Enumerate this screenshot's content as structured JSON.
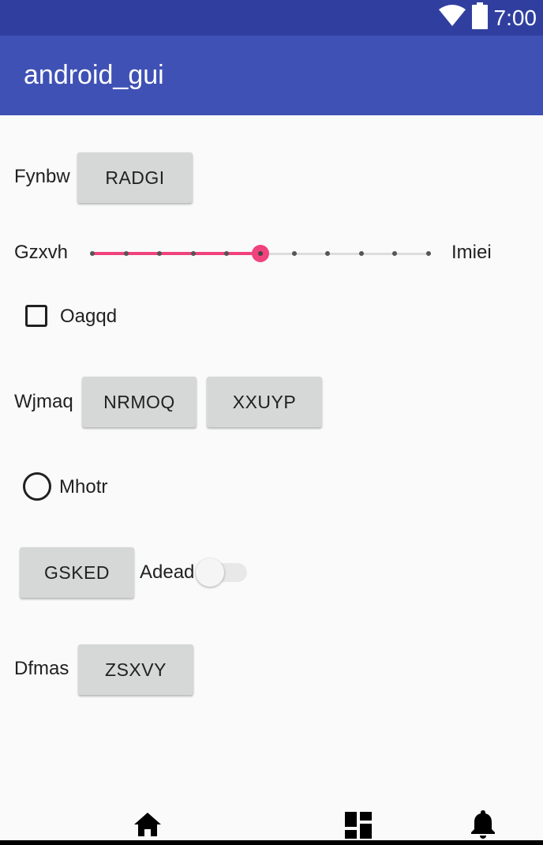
{
  "status_bar": {
    "time": "7:00",
    "icons": [
      "wifi-icon",
      "battery-icon"
    ]
  },
  "app_bar": {
    "title": "android_gui"
  },
  "rows": {
    "row1": {
      "label": "Fynbw",
      "button": "RADGI"
    },
    "slider": {
      "label_left": "Gzxvh",
      "label_right": "Imiei",
      "ticks": 11,
      "value_index": 5
    },
    "checkbox": {
      "label": "Oagqd",
      "checked": false
    },
    "row4": {
      "label": "Wjmaq",
      "button1": "NRMOQ",
      "button2": "XXUYP"
    },
    "radio": {
      "label": "Mhotr",
      "selected": false
    },
    "row6": {
      "button": "GSKED",
      "switch_label": "Adead",
      "switch_on": false
    },
    "row7": {
      "label": "Dfmas",
      "button": "ZSXVY"
    }
  },
  "bottom_nav": {
    "icons": [
      "home-icon",
      "dashboard-icon",
      "notifications-icon"
    ]
  },
  "colors": {
    "primary": "#3f51b5",
    "primary_dark": "#303f9f",
    "accent": "#f0427c"
  }
}
